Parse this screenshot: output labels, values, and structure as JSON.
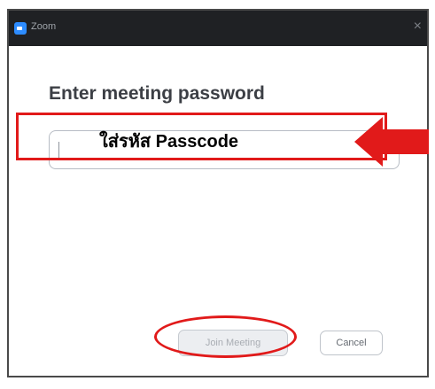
{
  "window": {
    "title": "Zoom",
    "close_glyph": "×"
  },
  "dialog": {
    "heading": "Enter meeting password",
    "password_value": "",
    "join_label": "Join Meeting",
    "cancel_label": "Cancel"
  },
  "annotation": {
    "text": "ใส่รหัส Passcode",
    "color": "#e11a1a"
  },
  "colors": {
    "titlebar": "#1f2124",
    "zoom_blue": "#2d8cff"
  },
  "icons": {
    "app": "zoom-app-icon",
    "close": "close-icon",
    "arrow": "red-arrow-icon"
  }
}
